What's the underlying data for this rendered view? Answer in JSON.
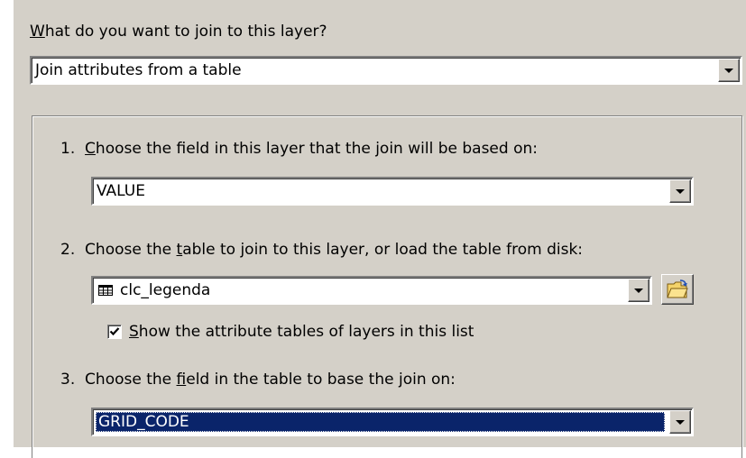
{
  "join_type": {
    "question_label": "What do you want to join to this layer?",
    "mnemonic": "W",
    "question_rest": "hat do you want to join to this layer?",
    "selected": "Join attributes from a table"
  },
  "step1": {
    "number": "1.",
    "label_mnemonic": "C",
    "label_rest": "hoose the field in this layer that the join will be based on:",
    "value": "VALUE"
  },
  "step2": {
    "number": "2.",
    "label_before": "Choose the ",
    "label_mnemonic": "t",
    "label_after": "able to join to this layer, or load the table from disk:",
    "value": "clc_legenda",
    "table_icon": "table-icon",
    "browse_icon": "open-folder-icon",
    "checkbox": {
      "checked": true,
      "label_mnemonic": "S",
      "label_rest": "how the attribute tables of layers in this list"
    }
  },
  "step3": {
    "number": "3.",
    "label_before": "Choose the ",
    "label_mnemonic": "f",
    "label_after": "ield in the table to base the join on:",
    "value": "GRID_CODE"
  },
  "colors": {
    "dialog_bg": "#d4d0c8",
    "selection_bg": "#0a246a",
    "selection_text": "#ffffff"
  }
}
